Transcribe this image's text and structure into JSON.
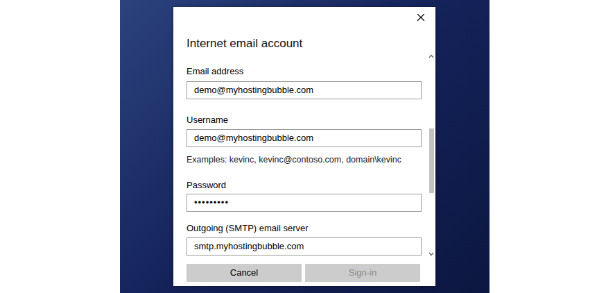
{
  "dialog": {
    "title": "Internet email account"
  },
  "fields": [
    {
      "label": "Email address",
      "value": "demo@myhostingbubble.com",
      "kind": "text",
      "hint": ""
    },
    {
      "label": "Username",
      "value": "demo@myhostingbubble.com",
      "kind": "text",
      "hint": "Examples: kevinc, kevinc@contoso.com, domain\\kevinc"
    },
    {
      "label": "Password",
      "value": "•••••••••",
      "kind": "password",
      "hint": ""
    },
    {
      "label": "Outgoing (SMTP) email server",
      "value": "smtp.myhostingbubble.com",
      "kind": "text",
      "hint": ""
    }
  ],
  "buttons": [
    {
      "label": "Cancel",
      "disabled": false
    },
    {
      "label": "Sign-in",
      "disabled": true
    }
  ]
}
